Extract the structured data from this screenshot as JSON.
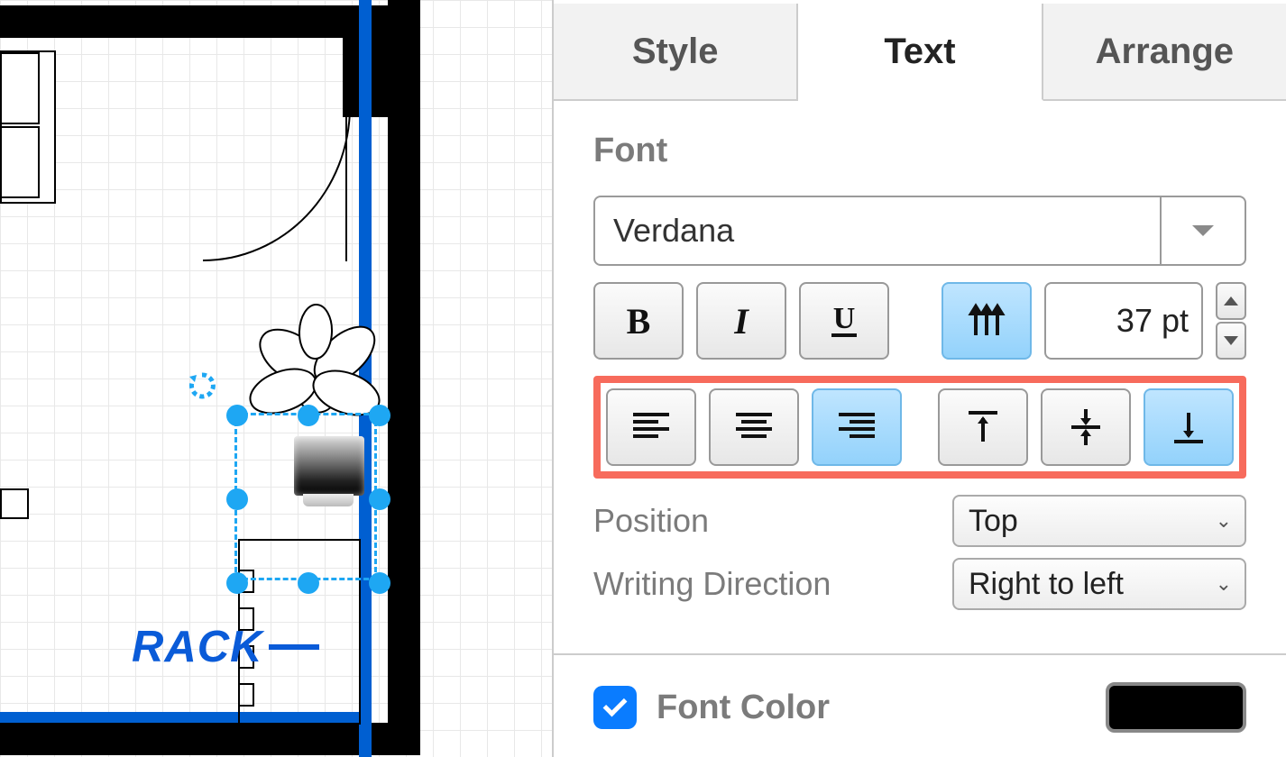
{
  "tabs": {
    "style": "Style",
    "text": "Text",
    "arrange": "Arrange",
    "active": "text"
  },
  "font": {
    "section_title": "Font",
    "family": "Verdana",
    "size_display": "37 pt"
  },
  "position": {
    "label": "Position",
    "value": "Top"
  },
  "writing_direction": {
    "label": "Writing Direction",
    "value": "Right to left"
  },
  "font_color": {
    "label": "Font Color",
    "checked": true,
    "swatch": "#000000"
  },
  "horizontal_align_active": "right",
  "vertical_align_active": "bottom",
  "vertical_text_active": true,
  "canvas": {
    "label_text": "RACK"
  }
}
